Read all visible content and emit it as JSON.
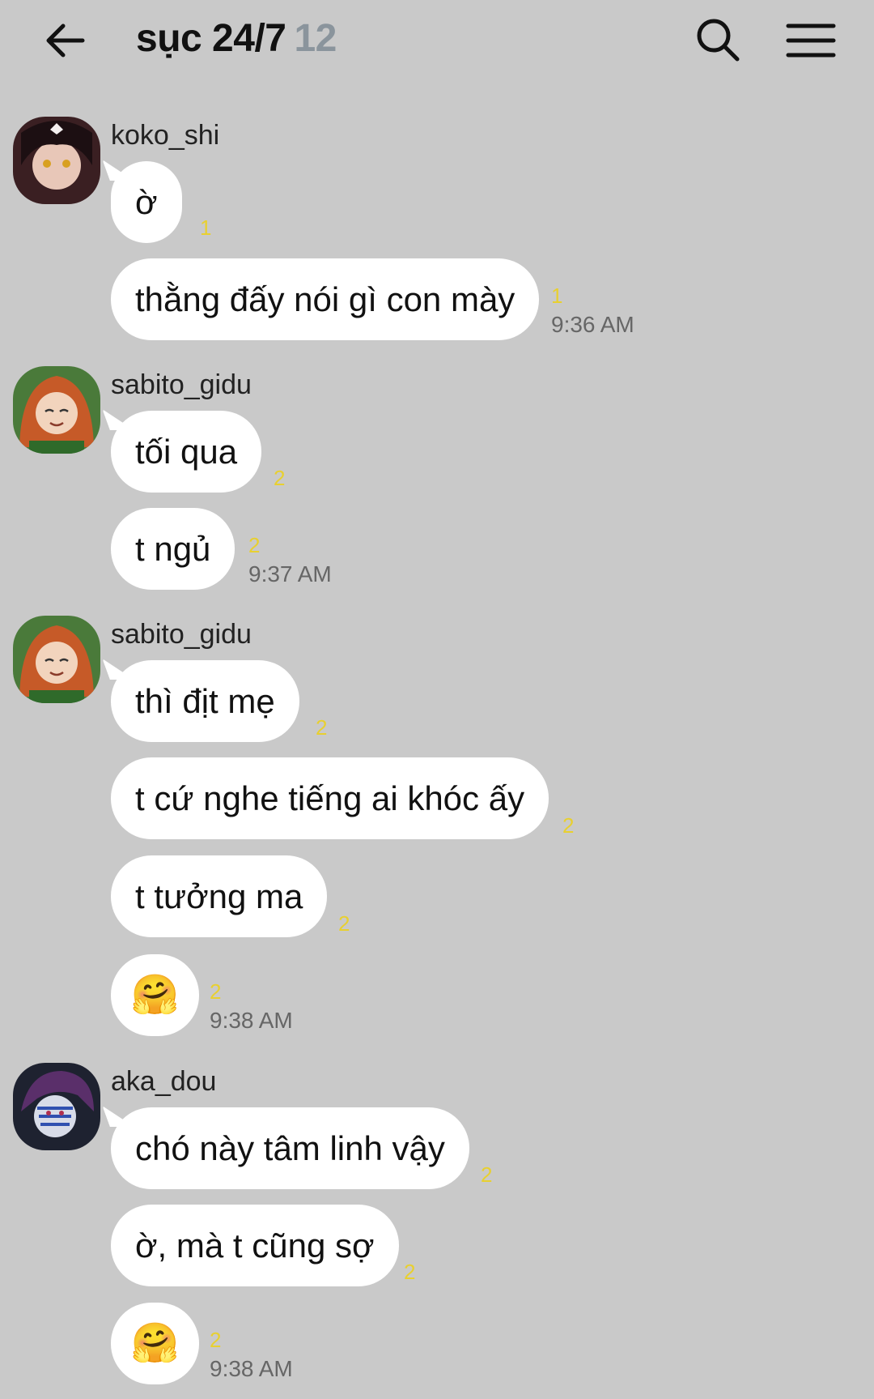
{
  "header": {
    "title": "sục 24/7",
    "member_count": "12",
    "back_icon": "arrow-left-icon",
    "search_icon": "search-icon",
    "menu_icon": "hamburger-menu-icon"
  },
  "groups": [
    {
      "sender": "koko_shi",
      "messages": [
        {
          "text": "ờ",
          "read": "1"
        },
        {
          "text": "thằng đấy nói gì con mày",
          "read": "1",
          "time": "9:36 AM"
        }
      ]
    },
    {
      "sender": "sabito_gidu",
      "messages": [
        {
          "text": "tối qua",
          "read": "2"
        },
        {
          "text": "t ngủ",
          "read": "2",
          "time": "9:37 AM"
        }
      ]
    },
    {
      "sender": "sabito_gidu",
      "messages": [
        {
          "text": "thì địt mẹ",
          "read": "2"
        },
        {
          "text": "t cứ nghe tiếng ai khóc ấy",
          "read": "2"
        },
        {
          "text": "t tưởng ma",
          "read": "2"
        },
        {
          "text": "🤗",
          "read": "2",
          "time": "9:38 AM"
        }
      ]
    },
    {
      "sender": "aka_dou",
      "messages": [
        {
          "text": "chó này tâm linh vậy",
          "read": "2"
        },
        {
          "text": "ờ, mà t cũng sợ",
          "read": "2"
        },
        {
          "text": "🤗",
          "read": "2",
          "time": "9:38 AM"
        }
      ]
    }
  ]
}
